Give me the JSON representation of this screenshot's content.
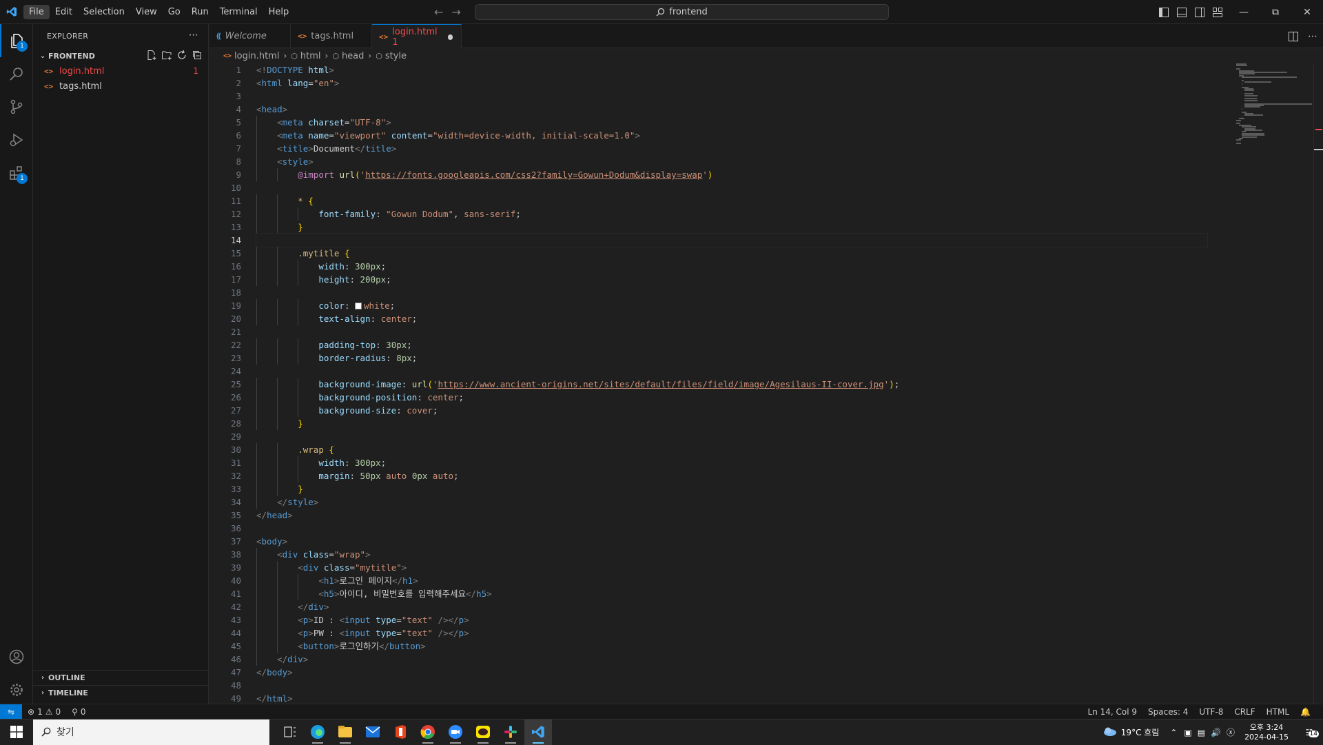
{
  "titlebar": {
    "menus": [
      "File",
      "Edit",
      "Selection",
      "View",
      "Go",
      "Run",
      "Terminal",
      "Help"
    ],
    "search_text": "frontend"
  },
  "activity": {
    "explorer_badge": "1",
    "extensions_badge": "1"
  },
  "sidebar": {
    "title": "EXPLORER",
    "folder": "FRONTEND",
    "files": [
      {
        "name": "login.html",
        "badge": "1"
      },
      {
        "name": "tags.html",
        "badge": ""
      }
    ],
    "outline": "OUTLINE",
    "timeline": "TIMELINE"
  },
  "tabs": [
    {
      "label": "Welcome"
    },
    {
      "label": "tags.html"
    },
    {
      "label": "login.html 1"
    }
  ],
  "breadcrumbs": [
    "login.html",
    "html",
    "head",
    "style"
  ],
  "editor": {
    "current_line": 14,
    "lines": [
      [
        [
          "t-tag",
          "<!"
        ],
        [
          "t-el",
          "DOCTYPE"
        ],
        [
          "t-txt",
          " "
        ],
        [
          "t-at",
          "html"
        ],
        [
          "t-tag",
          ">"
        ]
      ],
      [
        [
          "t-tag",
          "<"
        ],
        [
          "t-el",
          "html"
        ],
        [
          "t-txt",
          " "
        ],
        [
          "t-at",
          "lang"
        ],
        [
          "t-txt",
          "="
        ],
        [
          "t-str",
          "\"en\""
        ],
        [
          "t-tag",
          ">"
        ]
      ],
      [],
      [
        [
          "t-tag",
          "<"
        ],
        [
          "t-el",
          "head"
        ],
        [
          "t-tag",
          ">"
        ]
      ],
      [
        [
          "t-txt",
          "    "
        ],
        [
          "t-tag",
          "<"
        ],
        [
          "t-el",
          "meta"
        ],
        [
          "t-txt",
          " "
        ],
        [
          "t-at",
          "charset"
        ],
        [
          "t-txt",
          "="
        ],
        [
          "t-str",
          "\"UTF-8\""
        ],
        [
          "t-tag",
          ">"
        ]
      ],
      [
        [
          "t-txt",
          "    "
        ],
        [
          "t-tag",
          "<"
        ],
        [
          "t-el",
          "meta"
        ],
        [
          "t-txt",
          " "
        ],
        [
          "t-at",
          "name"
        ],
        [
          "t-txt",
          "="
        ],
        [
          "t-str",
          "\"viewport\""
        ],
        [
          "t-txt",
          " "
        ],
        [
          "t-at",
          "content"
        ],
        [
          "t-txt",
          "="
        ],
        [
          "t-str",
          "\"width=device-width, initial-scale=1.0\""
        ],
        [
          "t-tag",
          ">"
        ]
      ],
      [
        [
          "t-txt",
          "    "
        ],
        [
          "t-tag",
          "<"
        ],
        [
          "t-el",
          "title"
        ],
        [
          "t-tag",
          ">"
        ],
        [
          "t-txt",
          "Document"
        ],
        [
          "t-tag",
          "</"
        ],
        [
          "t-el",
          "title"
        ],
        [
          "t-tag",
          ">"
        ]
      ],
      [
        [
          "t-txt",
          "    "
        ],
        [
          "t-tag",
          "<"
        ],
        [
          "t-el",
          "style"
        ],
        [
          "t-tag",
          ">"
        ]
      ],
      [
        [
          "t-txt",
          "        "
        ],
        [
          "t-kw",
          "@import"
        ],
        [
          "t-txt",
          " "
        ],
        [
          "t-fn",
          "url"
        ],
        [
          "t-br",
          "("
        ],
        [
          "t-str",
          "'"
        ],
        [
          "t-url",
          "https://fonts.googleapis.com/css2?family=Gowun+Dodum&display=swap"
        ],
        [
          "t-str",
          "'"
        ],
        [
          "t-br",
          ")"
        ]
      ],
      [],
      [
        [
          "t-txt",
          "        "
        ],
        [
          "t-sel",
          "*"
        ],
        [
          "t-txt",
          " "
        ],
        [
          "t-br",
          "{"
        ]
      ],
      [
        [
          "t-txt",
          "            "
        ],
        [
          "t-prop",
          "font-family"
        ],
        [
          "t-txt",
          ": "
        ],
        [
          "t-val",
          "\"Gowun Dodum\""
        ],
        [
          "t-txt",
          ", "
        ],
        [
          "t-val",
          "sans-serif"
        ],
        [
          "t-txt",
          ";"
        ]
      ],
      [
        [
          "t-txt",
          "        "
        ],
        [
          "t-br",
          "}"
        ]
      ],
      [],
      [
        [
          "t-txt",
          "        "
        ],
        [
          "t-sel",
          ".mytitle"
        ],
        [
          "t-txt",
          " "
        ],
        [
          "t-br",
          "{"
        ]
      ],
      [
        [
          "t-txt",
          "            "
        ],
        [
          "t-prop",
          "width"
        ],
        [
          "t-txt",
          ": "
        ],
        [
          "t-num",
          "300px"
        ],
        [
          "t-txt",
          ";"
        ]
      ],
      [
        [
          "t-txt",
          "            "
        ],
        [
          "t-prop",
          "height"
        ],
        [
          "t-txt",
          ": "
        ],
        [
          "t-num",
          "200px"
        ],
        [
          "t-txt",
          ";"
        ]
      ],
      [],
      [
        [
          "t-txt",
          "            "
        ],
        [
          "t-prop",
          "color"
        ],
        [
          "t-txt",
          ": "
        ],
        [
          "swatch",
          ""
        ],
        [
          "t-val",
          "white"
        ],
        [
          "t-txt",
          ";"
        ]
      ],
      [
        [
          "t-txt",
          "            "
        ],
        [
          "t-prop",
          "text-align"
        ],
        [
          "t-txt",
          ": "
        ],
        [
          "t-val",
          "center"
        ],
        [
          "t-txt",
          ";"
        ]
      ],
      [],
      [
        [
          "t-txt",
          "            "
        ],
        [
          "t-prop",
          "padding-top"
        ],
        [
          "t-txt",
          ": "
        ],
        [
          "t-num",
          "30px"
        ],
        [
          "t-txt",
          ";"
        ]
      ],
      [
        [
          "t-txt",
          "            "
        ],
        [
          "t-prop",
          "border-radius"
        ],
        [
          "t-txt",
          ": "
        ],
        [
          "t-num",
          "8px"
        ],
        [
          "t-txt",
          ";"
        ]
      ],
      [],
      [
        [
          "t-txt",
          "            "
        ],
        [
          "t-prop",
          "background-image"
        ],
        [
          "t-txt",
          ": "
        ],
        [
          "t-fn",
          "url"
        ],
        [
          "t-br",
          "("
        ],
        [
          "t-str",
          "'"
        ],
        [
          "t-url",
          "https://www.ancient-origins.net/sites/default/files/field/image/Agesilaus-II-cover.jpg"
        ],
        [
          "t-str",
          "'"
        ],
        [
          "t-br",
          ")"
        ],
        [
          "t-txt",
          ";"
        ]
      ],
      [
        [
          "t-txt",
          "            "
        ],
        [
          "t-prop",
          "background-position"
        ],
        [
          "t-txt",
          ": "
        ],
        [
          "t-val",
          "center"
        ],
        [
          "t-txt",
          ";"
        ]
      ],
      [
        [
          "t-txt",
          "            "
        ],
        [
          "t-prop",
          "background-size"
        ],
        [
          "t-txt",
          ": "
        ],
        [
          "t-val",
          "cover"
        ],
        [
          "t-txt",
          ";"
        ]
      ],
      [
        [
          "t-txt",
          "        "
        ],
        [
          "t-br",
          "}"
        ]
      ],
      [],
      [
        [
          "t-txt",
          "        "
        ],
        [
          "t-sel",
          ".wrap"
        ],
        [
          "t-txt",
          " "
        ],
        [
          "t-br",
          "{"
        ]
      ],
      [
        [
          "t-txt",
          "            "
        ],
        [
          "t-prop",
          "width"
        ],
        [
          "t-txt",
          ": "
        ],
        [
          "t-num",
          "300px"
        ],
        [
          "t-txt",
          ";"
        ]
      ],
      [
        [
          "t-txt",
          "            "
        ],
        [
          "t-prop",
          "margin"
        ],
        [
          "t-txt",
          ": "
        ],
        [
          "t-num",
          "50px"
        ],
        [
          "t-txt",
          " "
        ],
        [
          "t-val",
          "auto"
        ],
        [
          "t-txt",
          " "
        ],
        [
          "t-num",
          "0px"
        ],
        [
          "t-txt",
          " "
        ],
        [
          "t-val",
          "auto"
        ],
        [
          "t-txt",
          ";"
        ]
      ],
      [
        [
          "t-txt",
          "        "
        ],
        [
          "t-br",
          "}"
        ]
      ],
      [
        [
          "t-txt",
          "    "
        ],
        [
          "t-tag",
          "</"
        ],
        [
          "t-el",
          "style"
        ],
        [
          "t-tag",
          ">"
        ]
      ],
      [
        [
          "t-tag",
          "</"
        ],
        [
          "t-el",
          "head"
        ],
        [
          "t-tag",
          ">"
        ]
      ],
      [],
      [
        [
          "t-tag",
          "<"
        ],
        [
          "t-el",
          "body"
        ],
        [
          "t-tag",
          ">"
        ]
      ],
      [
        [
          "t-txt",
          "    "
        ],
        [
          "t-tag",
          "<"
        ],
        [
          "t-el",
          "div"
        ],
        [
          "t-txt",
          " "
        ],
        [
          "t-at",
          "class"
        ],
        [
          "t-txt",
          "="
        ],
        [
          "t-str",
          "\"wrap\""
        ],
        [
          "t-tag",
          ">"
        ]
      ],
      [
        [
          "t-txt",
          "        "
        ],
        [
          "t-tag",
          "<"
        ],
        [
          "t-el",
          "div"
        ],
        [
          "t-txt",
          " "
        ],
        [
          "t-at",
          "class"
        ],
        [
          "t-txt",
          "="
        ],
        [
          "t-str",
          "\"mytitle\""
        ],
        [
          "t-tag",
          ">"
        ]
      ],
      [
        [
          "t-txt",
          "            "
        ],
        [
          "t-tag",
          "<"
        ],
        [
          "t-el",
          "h1"
        ],
        [
          "t-tag",
          ">"
        ],
        [
          "t-txt",
          "로그인 페이지"
        ],
        [
          "t-tag",
          "</"
        ],
        [
          "t-el",
          "h1"
        ],
        [
          "t-tag",
          ">"
        ]
      ],
      [
        [
          "t-txt",
          "            "
        ],
        [
          "t-tag",
          "<"
        ],
        [
          "t-el",
          "h5"
        ],
        [
          "t-tag",
          ">"
        ],
        [
          "t-txt",
          "아이디, 비밀번호를 입력해주세요"
        ],
        [
          "t-tag",
          "</"
        ],
        [
          "t-el",
          "h5"
        ],
        [
          "t-tag",
          ">"
        ]
      ],
      [
        [
          "t-txt",
          "        "
        ],
        [
          "t-tag",
          "</"
        ],
        [
          "t-el",
          "div"
        ],
        [
          "t-tag",
          ">"
        ]
      ],
      [
        [
          "t-txt",
          "        "
        ],
        [
          "t-tag",
          "<"
        ],
        [
          "t-el",
          "p"
        ],
        [
          "t-tag",
          ">"
        ],
        [
          "t-txt",
          "ID : "
        ],
        [
          "t-tag",
          "<"
        ],
        [
          "t-el",
          "input"
        ],
        [
          "t-txt",
          " "
        ],
        [
          "t-at",
          "type"
        ],
        [
          "t-txt",
          "="
        ],
        [
          "t-str",
          "\"text\""
        ],
        [
          "t-txt",
          " "
        ],
        [
          "t-tag",
          "/></"
        ],
        [
          "t-el",
          "p"
        ],
        [
          "t-tag",
          ">"
        ]
      ],
      [
        [
          "t-txt",
          "        "
        ],
        [
          "t-tag",
          "<"
        ],
        [
          "t-el",
          "p"
        ],
        [
          "t-tag",
          ">"
        ],
        [
          "t-txt",
          "PW : "
        ],
        [
          "t-tag",
          "<"
        ],
        [
          "t-el",
          "input"
        ],
        [
          "t-txt",
          " "
        ],
        [
          "t-at",
          "type"
        ],
        [
          "t-txt",
          "="
        ],
        [
          "t-str",
          "\"text\""
        ],
        [
          "t-txt",
          " "
        ],
        [
          "t-tag",
          "/></"
        ],
        [
          "t-el",
          "p"
        ],
        [
          "t-tag",
          ">"
        ]
      ],
      [
        [
          "t-txt",
          "        "
        ],
        [
          "t-tag",
          "<"
        ],
        [
          "t-el",
          "button"
        ],
        [
          "t-tag",
          ">"
        ],
        [
          "t-txt",
          "로그인하기"
        ],
        [
          "t-tag",
          "</"
        ],
        [
          "t-el",
          "button"
        ],
        [
          "t-tag",
          ">"
        ]
      ],
      [
        [
          "t-txt",
          "    "
        ],
        [
          "t-tag",
          "</"
        ],
        [
          "t-el",
          "div"
        ],
        [
          "t-tag",
          ">"
        ]
      ],
      [
        [
          "t-tag",
          "</"
        ],
        [
          "t-el",
          "body"
        ],
        [
          "t-tag",
          ">"
        ]
      ],
      [],
      [
        [
          "t-tag",
          "</"
        ],
        [
          "t-el",
          "html"
        ],
        [
          "t-tag",
          ">"
        ]
      ]
    ]
  },
  "statusbar": {
    "errors": "1",
    "warnings": "0",
    "ports": "0",
    "position": "Ln 14, Col 9",
    "spaces": "Spaces: 4",
    "encoding": "UTF-8",
    "eol": "CRLF",
    "language": "HTML"
  },
  "taskbar": {
    "search_placeholder": "찾기",
    "weather": "19°C 흐림",
    "time": "오후 3:24",
    "date": "2024-04-15",
    "notifications": "14"
  },
  "colors": {
    "accent": "#0078d4",
    "error": "#f14c4c",
    "background": "#1f1f1f"
  }
}
